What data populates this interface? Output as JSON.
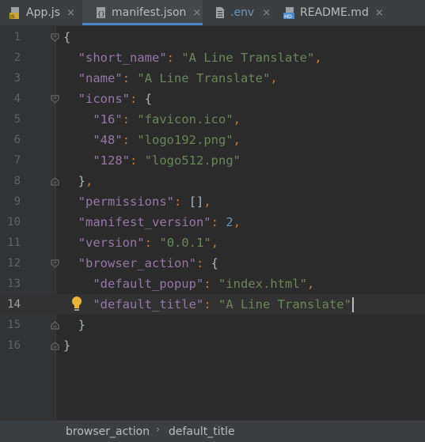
{
  "tabs": [
    {
      "label": "App.js",
      "icon": "js-file-icon",
      "active": false
    },
    {
      "label": "manifest.json",
      "icon": "json-file-icon",
      "active": true
    },
    {
      "label": ".env",
      "icon": "text-file-icon",
      "active": false
    },
    {
      "label": "README.md",
      "icon": "markdown-file-icon",
      "active": false
    }
  ],
  "icons": {
    "close": "×",
    "js": "JS",
    "md": "MD",
    "json": "{}"
  },
  "editor": {
    "line_numbers": [
      "1",
      "2",
      "3",
      "4",
      "5",
      "6",
      "7",
      "8",
      "9",
      "10",
      "11",
      "12",
      "13",
      "14",
      "15",
      "16"
    ],
    "current_line": "14",
    "lines": [
      "{",
      "  \"short_name\": \"A Line Translate\",",
      "  \"name\": \"A Line Translate\",",
      "  \"icons\": {",
      "    \"16\": \"favicon.ico\",",
      "    \"48\": \"logo192.png\",",
      "    \"128\": \"logo512.png\"",
      "  },",
      "  \"permissions\": [],",
      "  \"manifest_version\": 2,",
      "  \"version\": \"0.0.1\",",
      "  \"browser_action\": {",
      "    \"default_popup\": \"index.html\",",
      "    \"default_title\": \"A Line Translate\"",
      "  }",
      "}"
    ]
  },
  "breadcrumb": {
    "items": [
      "browser_action",
      "default_title"
    ],
    "separator": "›"
  },
  "colors": {
    "key": "#9876aa",
    "string": "#6a8759",
    "number": "#6897bb",
    "punct": "#cc7832",
    "text": "#a9b7c6",
    "accent": "#4a88c7"
  }
}
